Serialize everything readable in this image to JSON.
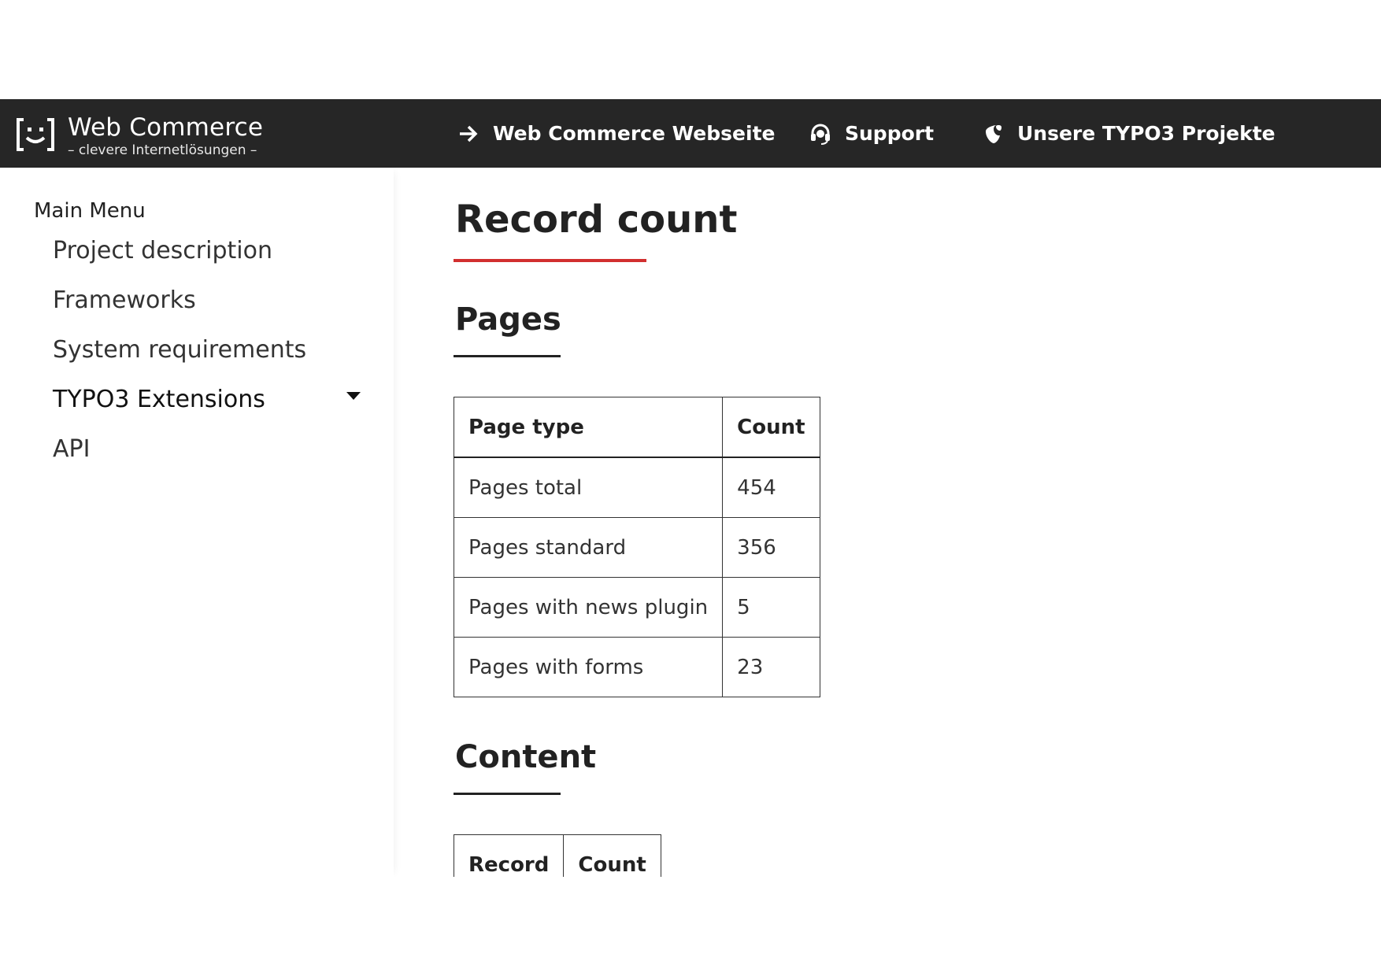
{
  "header": {
    "logo_title": "Web Commerce",
    "logo_subtitle": "– clevere Internetlösungen –",
    "links": [
      {
        "label": "Web Commerce Webseite",
        "icon": "arrow-right-icon"
      },
      {
        "label": "Support",
        "icon": "headset-icon"
      },
      {
        "label": "Unsere TYPO3 Projekte",
        "icon": "typo3-icon"
      }
    ],
    "background": "#262626"
  },
  "sidebar": {
    "heading": "Main Menu",
    "items": [
      {
        "label": "Project description"
      },
      {
        "label": "Frameworks"
      },
      {
        "label": "System requirements"
      },
      {
        "label": "TYPO3 Extensions",
        "has_submenu": true
      },
      {
        "label": "API"
      }
    ]
  },
  "main": {
    "title": "Record count",
    "accent_color": "#d22f2f",
    "pages_section": {
      "heading": "Pages",
      "columns": [
        "Page type",
        "Count"
      ],
      "rows": [
        [
          "Pages total",
          "454"
        ],
        [
          "Pages standard",
          "356"
        ],
        [
          "Pages with news plugin",
          "5"
        ],
        [
          "Pages with forms",
          "23"
        ]
      ]
    },
    "content_section": {
      "heading": "Content",
      "columns": [
        "Record",
        "Count"
      ]
    }
  }
}
